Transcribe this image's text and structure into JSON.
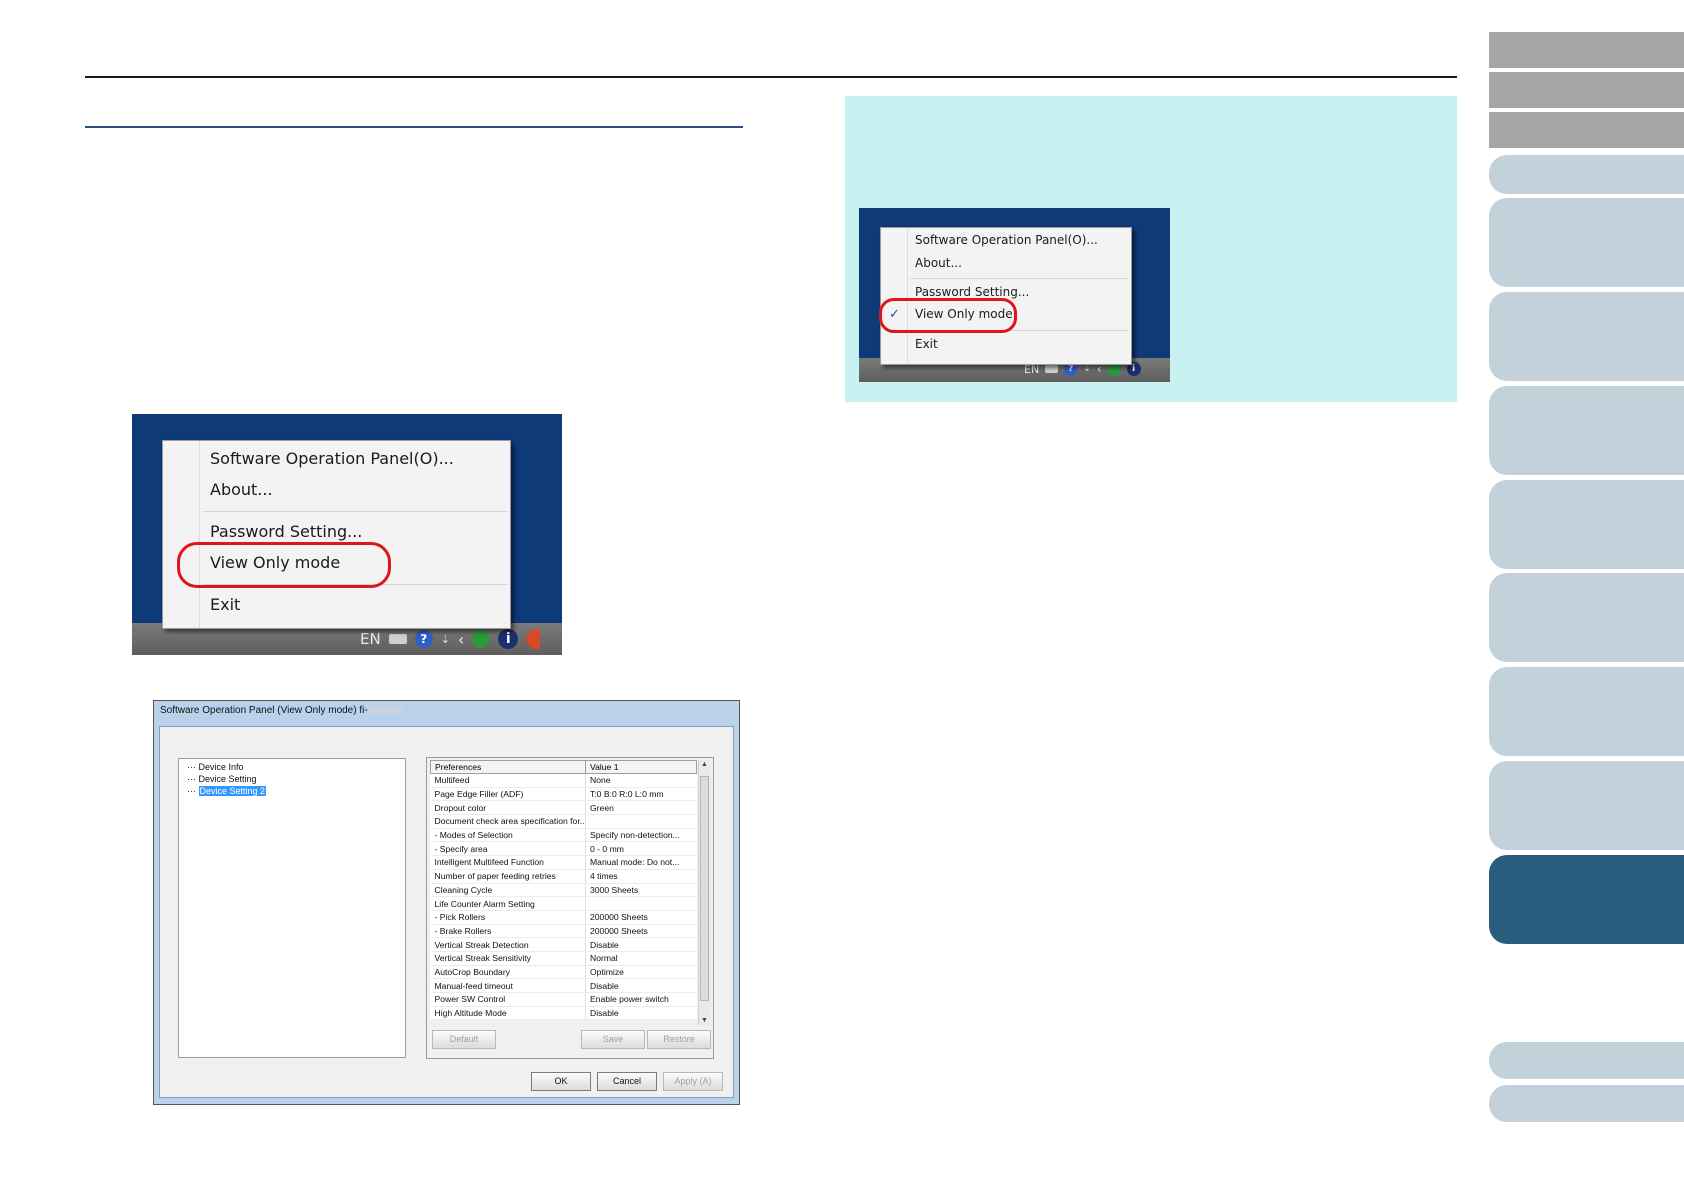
{
  "nav_tabs": {
    "gray_count": 3,
    "light_count": 7,
    "active_index": 7
  },
  "menu_large": {
    "items": [
      "Software Operation Panel(O)...",
      "About...",
      "Password Setting...",
      "View Only mode",
      "Exit"
    ],
    "tray_lang": "EN"
  },
  "menu_small": {
    "items": [
      "Software Operation Panel(O)...",
      "About...",
      "Password Setting...",
      "View Only mode",
      "Exit"
    ],
    "checked_item": "View Only mode",
    "check_mark": "✓",
    "tray_lang": "EN"
  },
  "dialog": {
    "title": "Software Operation Panel (View Only mode) fi-",
    "tree": [
      "Device Info",
      "Device Setting",
      "Device Setting 2"
    ],
    "selected_tree_item": "Device Setting 2",
    "columns": [
      "Preferences",
      "Value 1"
    ],
    "rows": [
      [
        "Multifeed",
        "None"
      ],
      [
        "Page Edge Filler (ADF)",
        "T:0  B:0  R:0  L:0 mm"
      ],
      [
        "Dropout color",
        "Green"
      ],
      [
        "Document check area specification for...",
        ""
      ],
      [
        " - Modes of Selection",
        "Specify non-detection..."
      ],
      [
        " - Specify area",
        "0 - 0 mm"
      ],
      [
        "Intelligent Multifeed Function",
        "Manual mode: Do not..."
      ],
      [
        "Number of paper feeding retries",
        "4 times"
      ],
      [
        "Cleaning Cycle",
        "3000 Sheets"
      ],
      [
        "Life Counter Alarm Setting",
        ""
      ],
      [
        " - Pick Rollers",
        "200000 Sheets"
      ],
      [
        " - Brake Rollers",
        "200000 Sheets"
      ],
      [
        "Vertical Streak Detection",
        "Disable"
      ],
      [
        "Vertical Streak Sensitivity",
        "Normal"
      ],
      [
        "AutoCrop Boundary",
        "Optimize"
      ],
      [
        "Manual-feed timeout",
        "Disable"
      ],
      [
        "Power SW Control",
        "Enable power switch"
      ],
      [
        "High Altitude Mode",
        "Disable"
      ]
    ],
    "grid_buttons": [
      "Default",
      "Save",
      "Restore"
    ],
    "buttons": [
      "OK",
      "Cancel",
      "Apply (A)"
    ]
  }
}
